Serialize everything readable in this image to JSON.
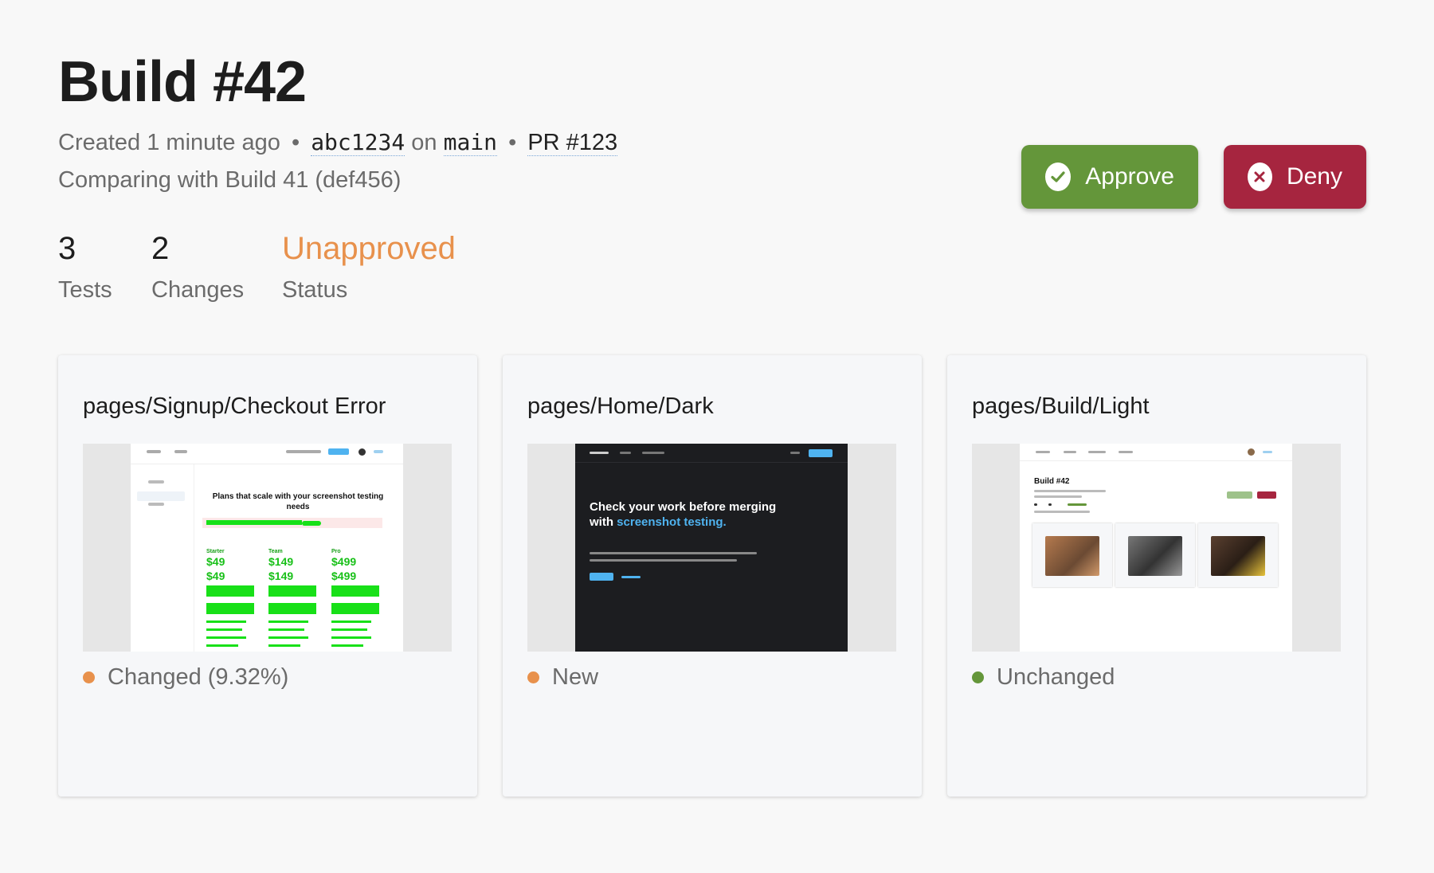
{
  "header": {
    "title": "Build #42",
    "created": "Created 1 minute ago",
    "commit": "abc1234",
    "on": "on",
    "branch": "main",
    "bullet": "•",
    "pr": "PR #123",
    "comparing": "Comparing with Build 41 (def456)"
  },
  "stats": {
    "tests": {
      "value": "3",
      "label": "Tests"
    },
    "changes": {
      "value": "2",
      "label": "Changes"
    },
    "status": {
      "value": "Unapproved",
      "label": "Status"
    }
  },
  "actions": {
    "approve_label": "Approve",
    "deny_label": "Deny"
  },
  "colors": {
    "approve": "#64963a",
    "deny": "#a6253f",
    "changed": "#e8914c",
    "new": "#e8914c",
    "unchanged": "#64963a"
  },
  "cards": [
    {
      "title": "pages/Signup/Checkout Error",
      "status": "Changed (9.32%)",
      "preview": {
        "heading": "Plans that scale with your screenshot testing needs",
        "plans": [
          "Starter",
          "Team",
          "Pro"
        ],
        "prices": [
          "$49",
          "$149",
          "$499"
        ]
      }
    },
    {
      "title": "pages/Home/Dark",
      "status": "New",
      "preview": {
        "heading_a": "Check your work before merging with ",
        "heading_b": "screenshot testing."
      }
    },
    {
      "title": "pages/Build/Light",
      "status": "Unchanged",
      "preview": {
        "heading": "Build #42"
      }
    }
  ]
}
